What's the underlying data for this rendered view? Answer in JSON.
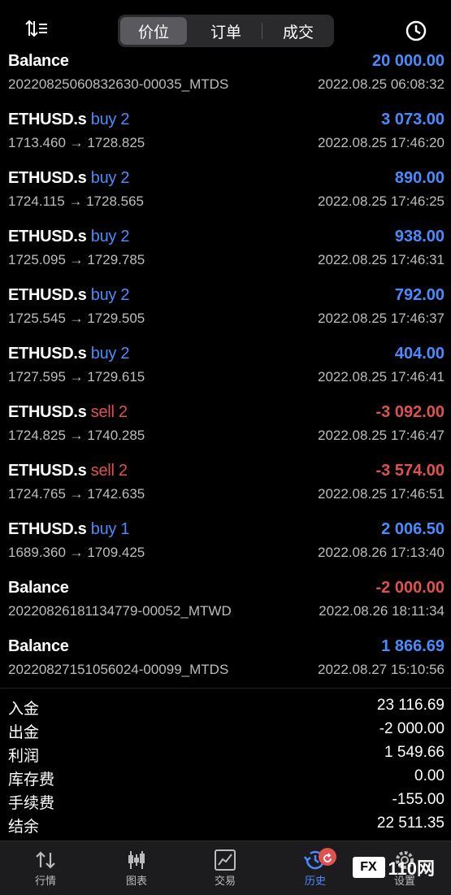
{
  "header": {
    "tabs": [
      {
        "label": "价位",
        "active": true
      },
      {
        "label": "订单",
        "active": false
      },
      {
        "label": "成交",
        "active": false
      }
    ],
    "sort_icon": "sort-icon",
    "history_icon": "clock-icon"
  },
  "rows": [
    {
      "symbol": "Balance",
      "side": "",
      "sub": "20220825060832630-00035_MTDS",
      "amount": "20 000.00",
      "sign": "pos",
      "time": "2022.08.25 06:08:32"
    },
    {
      "symbol": "ETHUSD.s",
      "side": "buy 2",
      "side_type": "buy",
      "sub": "1713.460 → 1728.825",
      "amount": "3 073.00",
      "sign": "pos",
      "time": "2022.08.25 17:46:20"
    },
    {
      "symbol": "ETHUSD.s",
      "side": "buy 2",
      "side_type": "buy",
      "sub": "1724.115 → 1728.565",
      "amount": "890.00",
      "sign": "pos",
      "time": "2022.08.25 17:46:25"
    },
    {
      "symbol": "ETHUSD.s",
      "side": "buy 2",
      "side_type": "buy",
      "sub": "1725.095 → 1729.785",
      "amount": "938.00",
      "sign": "pos",
      "time": "2022.08.25 17:46:31"
    },
    {
      "symbol": "ETHUSD.s",
      "side": "buy 2",
      "side_type": "buy",
      "sub": "1725.545 → 1729.505",
      "amount": "792.00",
      "sign": "pos",
      "time": "2022.08.25 17:46:37"
    },
    {
      "symbol": "ETHUSD.s",
      "side": "buy 2",
      "side_type": "buy",
      "sub": "1727.595 → 1729.615",
      "amount": "404.00",
      "sign": "pos",
      "time": "2022.08.25 17:46:41"
    },
    {
      "symbol": "ETHUSD.s",
      "side": "sell 2",
      "side_type": "sell",
      "sub": "1724.825 → 1740.285",
      "amount": "-3 092.00",
      "sign": "neg",
      "time": "2022.08.25 17:46:47"
    },
    {
      "symbol": "ETHUSD.s",
      "side": "sell 2",
      "side_type": "sell",
      "sub": "1724.765 → 1742.635",
      "amount": "-3 574.00",
      "sign": "neg",
      "time": "2022.08.25 17:46:51"
    },
    {
      "symbol": "ETHUSD.s",
      "side": "buy 1",
      "side_type": "buy",
      "sub": "1689.360 → 1709.425",
      "amount": "2 006.50",
      "sign": "pos",
      "time": "2022.08.26 17:13:40"
    },
    {
      "symbol": "Balance",
      "side": "",
      "sub": "20220826181134779-00052_MTWD",
      "amount": "-2 000.00",
      "sign": "neg",
      "time": "2022.08.26 18:11:34"
    },
    {
      "symbol": "Balance",
      "side": "",
      "sub": "20220827151056024-00099_MTDS",
      "amount": "1 866.69",
      "sign": "pos",
      "time": "2022.08.27 15:10:56"
    }
  ],
  "summary": [
    {
      "label": "入金",
      "value": "23 116.69"
    },
    {
      "label": "出金",
      "value": "-2 000.00"
    },
    {
      "label": "利润",
      "value": "1 549.66"
    },
    {
      "label": "库存费",
      "value": "0.00"
    },
    {
      "label": "手续费",
      "value": "-155.00"
    },
    {
      "label": "结余",
      "value": "22 511.35"
    }
  ],
  "nav": [
    {
      "label": "行情",
      "icon": "quotes-icon",
      "active": false
    },
    {
      "label": "图表",
      "icon": "chart-icon",
      "active": false
    },
    {
      "label": "交易",
      "icon": "trade-icon",
      "active": false
    },
    {
      "label": "历史",
      "icon": "history-icon",
      "active": true
    },
    {
      "label": "设置",
      "icon": "settings-icon",
      "active": false
    }
  ],
  "watermark": {
    "box": "FX",
    "text": "110网"
  },
  "colors": {
    "buy": "#4a8cff",
    "sell": "#e0524f",
    "bg": "#000000"
  }
}
